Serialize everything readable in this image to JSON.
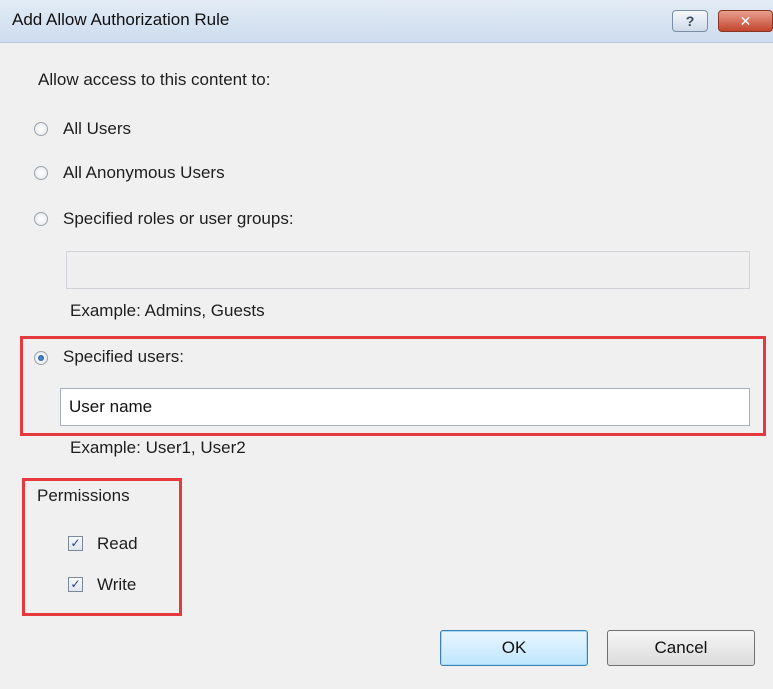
{
  "window": {
    "title": "Add Allow Authorization Rule",
    "help_glyph": "?",
    "close_glyph": "✕"
  },
  "form": {
    "prompt": "Allow access to this content to:",
    "options": [
      {
        "label": "All Users",
        "checked": false
      },
      {
        "label": "All Anonymous Users",
        "checked": false
      },
      {
        "label": "Specified roles or user groups:",
        "checked": false
      },
      {
        "label": "Specified users:",
        "checked": true
      }
    ],
    "roles_field": {
      "value": "",
      "enabled": false
    },
    "roles_example": "Example: Admins, Guests",
    "users_field": {
      "value": "User name",
      "enabled": true
    },
    "users_example": "Example: User1, User2"
  },
  "permissions": {
    "heading": "Permissions",
    "items": [
      {
        "label": "Read",
        "checked": true
      },
      {
        "label": "Write",
        "checked": true
      }
    ]
  },
  "buttons": {
    "ok": "OK",
    "cancel": "Cancel"
  },
  "colors": {
    "highlight": "#e5393d",
    "titlebar": "#cddcee"
  }
}
